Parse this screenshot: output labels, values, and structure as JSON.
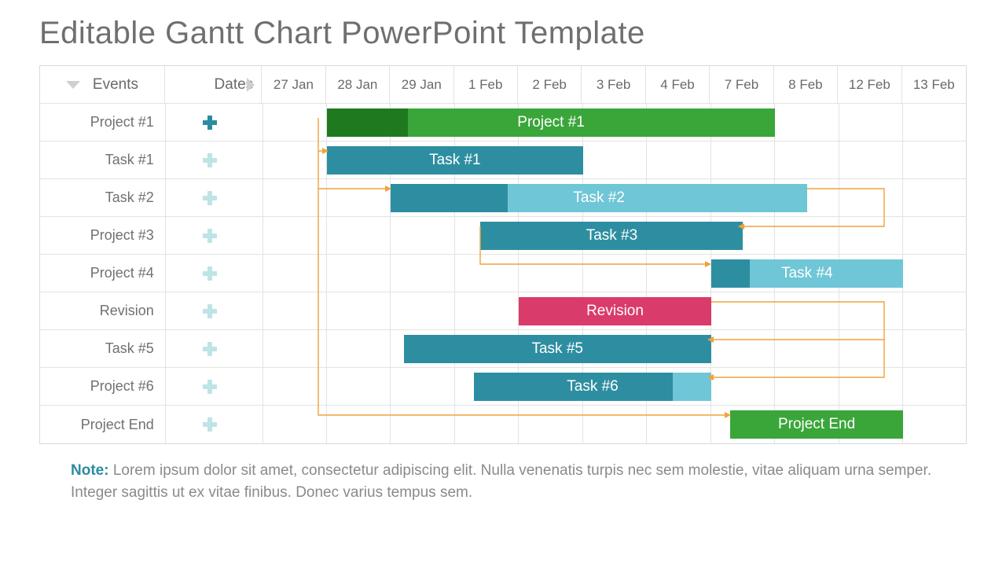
{
  "title": "Editable Gantt Chart PowerPoint Template",
  "columns": {
    "events": "Events",
    "dates": "Dates"
  },
  "note": {
    "label": "Note:",
    "text": "Lorem ipsum dolor sit amet, consectetur adipiscing elit. Nulla venenatis turpis nec sem molestie, vitae aliquam urna semper. Integer sagittis ut ex vitae finibus. Donec varius tempus sem."
  },
  "chart_data": {
    "type": "bar",
    "title": "Editable Gantt Chart PowerPoint Template",
    "categories": [
      "27 Jan",
      "28 Jan",
      "29 Jan",
      "1 Feb",
      "2 Feb",
      "3 Feb",
      "4 Feb",
      "7 Feb",
      "8 Feb",
      "12 Feb",
      "13 Feb"
    ],
    "xlabel": "",
    "ylabel": "",
    "series": [
      {
        "name": "Project #1",
        "label": "Project #1",
        "start": 1,
        "end": 8,
        "progress": 0.18,
        "color": "#3aa63a",
        "progressColor": "#1f7a1f"
      },
      {
        "name": "Task #1",
        "label": "Task #1",
        "start": 1,
        "end": 5,
        "progress": 0,
        "color": "#2e8ea1"
      },
      {
        "name": "Task #2",
        "label": "Task #2",
        "start": 2,
        "end": 8.5,
        "progress": 0.28,
        "color": "#6fc6d6",
        "progressColor": "#2e8ea1"
      },
      {
        "name": "Project #3",
        "label": "Task #3",
        "start": 3.4,
        "end": 7.5,
        "progress": 0,
        "color": "#2e8ea1"
      },
      {
        "name": "Project #4",
        "label": "Task #4",
        "start": 7,
        "end": 10,
        "progress": 0.2,
        "color": "#6fc6d6",
        "progressColor": "#2e8ea1"
      },
      {
        "name": "Revision",
        "label": "Revision",
        "start": 4,
        "end": 7,
        "progress": 0,
        "color": "#d93b6a"
      },
      {
        "name": "Task #5",
        "label": "Task #5",
        "start": 2.2,
        "end": 7,
        "progress": 0,
        "color": "#2e8ea1"
      },
      {
        "name": "Project #6",
        "label": "Task #6",
        "start": 3.3,
        "end": 7,
        "progress": 0.84,
        "color": "#6fc6d6",
        "progressColor": "#2e8ea1"
      },
      {
        "name": "Project End",
        "label": "Project End",
        "start": 7.3,
        "end": 10,
        "progress": 0,
        "color": "#3aa63a"
      }
    ]
  }
}
